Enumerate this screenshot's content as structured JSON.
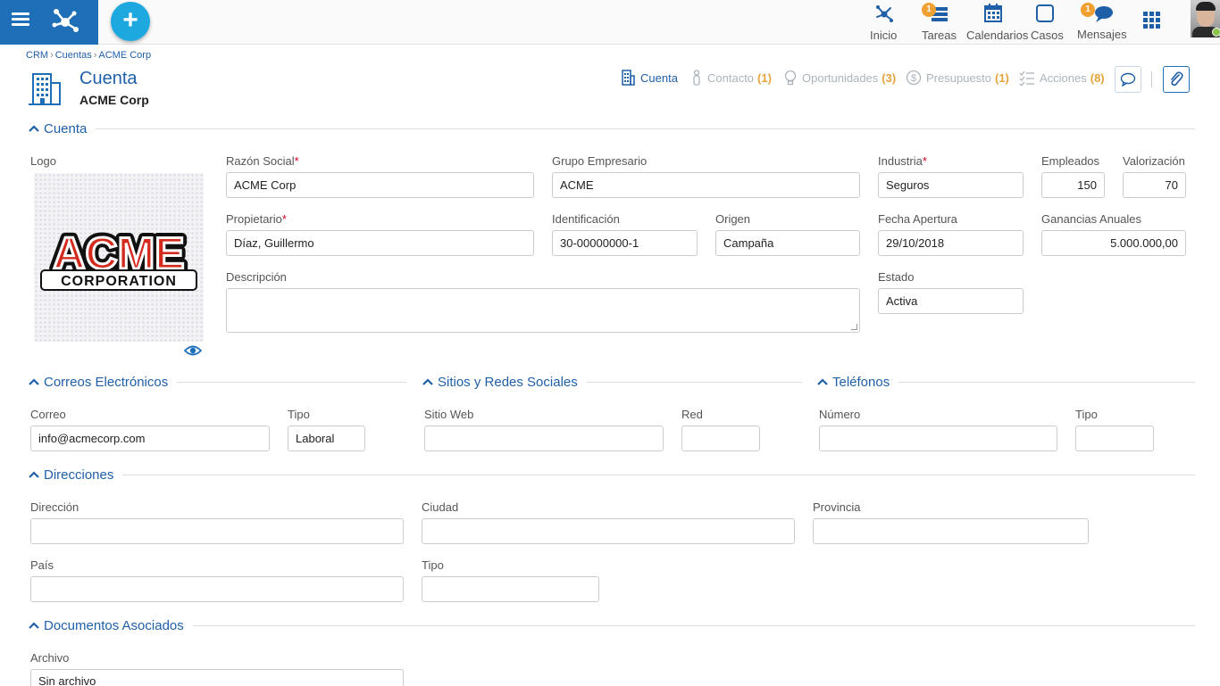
{
  "topbar": {
    "nav": [
      {
        "label": "Inicio",
        "icon": "hub-icon"
      },
      {
        "label": "Tareas",
        "icon": "tasks-icon",
        "badge": "1"
      },
      {
        "label": "Calendarios",
        "icon": "calendar-icon"
      },
      {
        "label": "Casos",
        "icon": "cases-icon"
      },
      {
        "label": "Mensajes",
        "icon": "messages-icon",
        "badge": "1"
      }
    ],
    "add_label": "+"
  },
  "breadcrumb": [
    "CRM",
    "Cuentas",
    "ACME Corp"
  ],
  "page": {
    "title": "Cuenta",
    "subtitle": "ACME Corp"
  },
  "tabs": [
    {
      "label": "Cuenta",
      "count": "",
      "active": true
    },
    {
      "label": "Contacto",
      "count": "(1)"
    },
    {
      "label": "Oportunidades",
      "count": "(3)"
    },
    {
      "label": "Presupuesto",
      "count": "(1)"
    },
    {
      "label": "Acciones",
      "count": "(8)"
    }
  ],
  "sections": {
    "cuenta": "Cuenta",
    "correos": "Correos Electrónicos",
    "sitios": "Sitios y Redes Sociales",
    "telefonos": "Teléfonos",
    "direcciones": "Direcciones",
    "documentos": "Documentos Asociados"
  },
  "logo": {
    "label": "Logo",
    "line1": "ACME",
    "line2": "CORPORATION"
  },
  "account": {
    "razon_social": {
      "label": "Razón Social",
      "value": "ACME Corp"
    },
    "grupo": {
      "label": "Grupo Empresario",
      "value": "ACME"
    },
    "industria": {
      "label": "Industria",
      "value": "Seguros"
    },
    "empleados": {
      "label": "Empleados",
      "value": "150"
    },
    "valorizacion": {
      "label": "Valorización",
      "value": "70"
    },
    "propietario": {
      "label": "Propietario",
      "value": "Díaz, Guillermo"
    },
    "identificacion": {
      "label": "Identificación",
      "value": "30-00000000-1"
    },
    "origen": {
      "label": "Origen",
      "value": "Campaña"
    },
    "fecha": {
      "label": "Fecha Apertura",
      "value": "29/10/2018"
    },
    "ganancias": {
      "label": "Ganancias Anuales",
      "value": "5.000.000,00"
    },
    "descripcion": {
      "label": "Descripción",
      "value": ""
    },
    "estado": {
      "label": "Estado",
      "value": "Activa"
    }
  },
  "correos": {
    "correo_label": "Correo",
    "correo_value": "info@acmecorp.com",
    "tipo_label": "Tipo",
    "tipo_value": "Laboral"
  },
  "sitios": {
    "sitio_label": "Sitio Web",
    "red_label": "Red"
  },
  "telefonos": {
    "numero_label": "Número",
    "tipo_label": "Tipo"
  },
  "direcciones": {
    "direccion_label": "Dirección",
    "ciudad_label": "Ciudad",
    "provincia_label": "Provincia",
    "pais_label": "País",
    "tipo_label": "Tipo"
  },
  "documentos": {
    "archivo_label": "Archivo",
    "archivo_value": "Sin archivo"
  },
  "colors": {
    "primary": "#1f6fb8",
    "accent": "#1ea8e0",
    "badge": "#f0a030"
  }
}
